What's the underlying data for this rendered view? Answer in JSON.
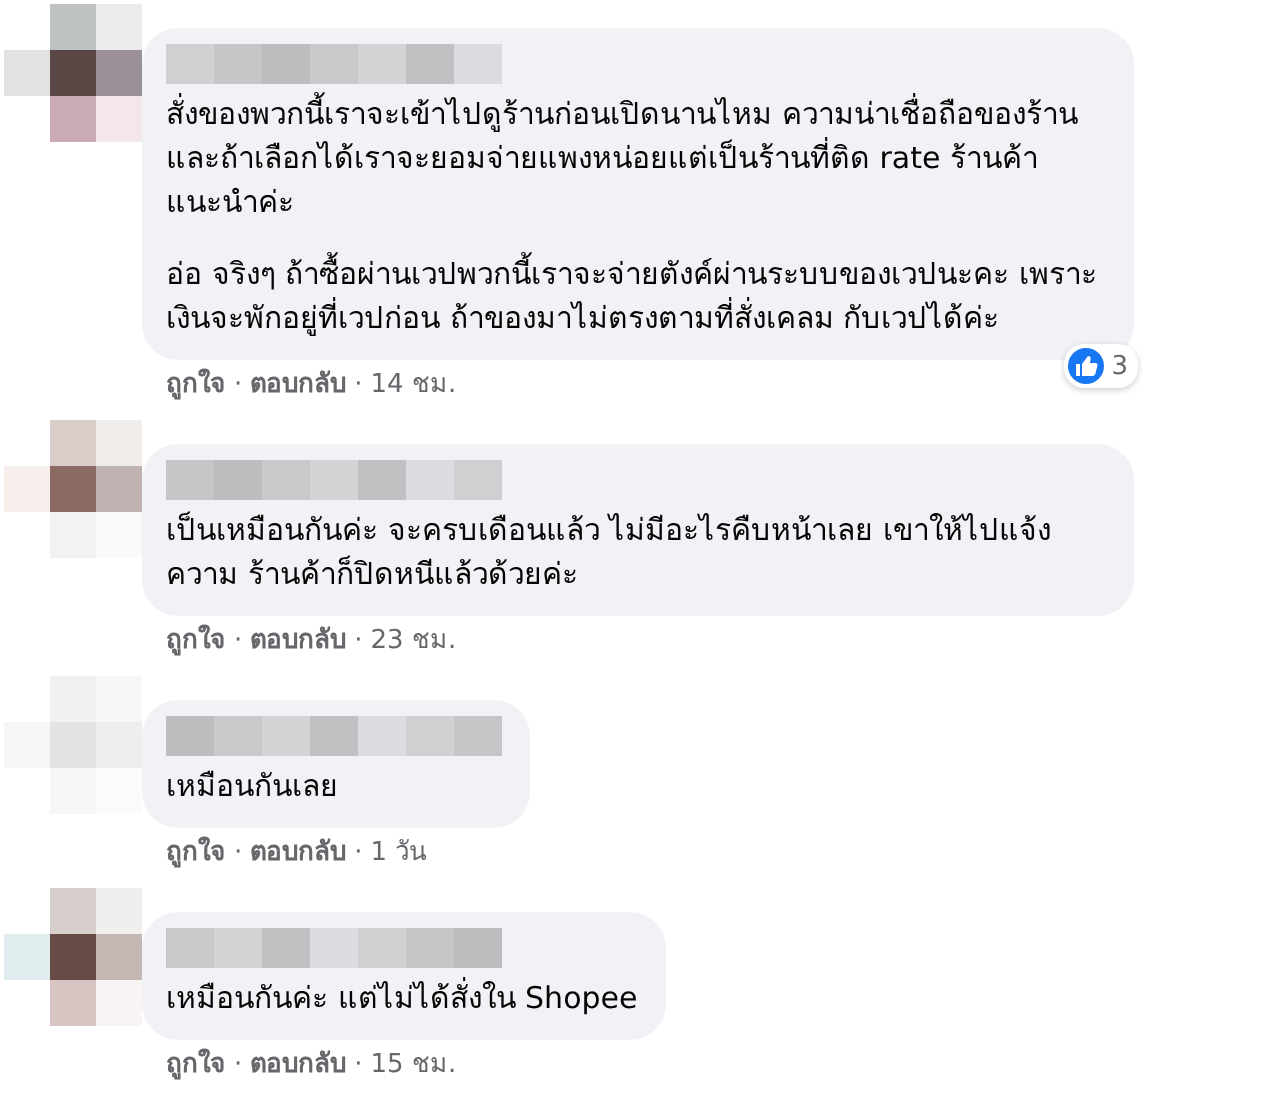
{
  "comments": [
    {
      "paragraphs": [
        "สั่งของพวกนี้เราจะเข้าไปดูร้านก่อนเปิดนานไหม ความน่าเชื่อถือของร้าน และถ้าเลือกได้เราจะยอมจ่ายแพงหน่อยแต่เป็นร้านที่ติด rate ร้านค้าแนะนำค่ะ",
        "อ่อ จริงๆ ถ้าซื้อผ่านเวปพวกนี้เราจะจ่ายตังค์ผ่านระบบของเวปนะคะ เพราะเงินจะพักอยู่ที่เวปก่อน ถ้าของมาไม่ตรงตามที่สั่งเคลม กับเวปได้ค่ะ"
      ],
      "reactions": {
        "count": "3"
      },
      "actions": [
        {
          "kind": "link",
          "text": "ถูกใจ"
        },
        {
          "kind": "sep",
          "text": "·"
        },
        {
          "kind": "link",
          "text": "ตอบกลับ"
        },
        {
          "kind": "sep",
          "text": "·"
        },
        {
          "kind": "time",
          "text": "14 ชม."
        }
      ]
    },
    {
      "paragraphs": [
        "เป็นเหมือนกันค่ะ จะครบเดือนแล้ว ไม่มีอะไรคืบหน้าเลย เขาให้ไปแจ้งความ ร้านค้าก็ปิดหนีแล้วด้วยค่ะ"
      ],
      "actions": [
        {
          "kind": "link",
          "text": "ถูกใจ"
        },
        {
          "kind": "sep",
          "text": "·"
        },
        {
          "kind": "link",
          "text": "ตอบกลับ"
        },
        {
          "kind": "sep",
          "text": "·"
        },
        {
          "kind": "time",
          "text": "23 ชม."
        }
      ]
    },
    {
      "paragraphs": [
        "เหมือนกันเลย"
      ],
      "actions": [
        {
          "kind": "link",
          "text": "ถูกใจ"
        },
        {
          "kind": "sep",
          "text": "·"
        },
        {
          "kind": "link",
          "text": "ตอบกลับ"
        },
        {
          "kind": "sep",
          "text": "·"
        },
        {
          "kind": "time",
          "text": "1 วัน"
        }
      ]
    },
    {
      "paragraphs": [
        "เหมือนกันค่ะ แต่ไม่ได้สั่งใน Shopee"
      ],
      "actions": [
        {
          "kind": "link",
          "text": "ถูกใจ"
        },
        {
          "kind": "sep",
          "text": "·"
        },
        {
          "kind": "link",
          "text": "ตอบกลับ"
        },
        {
          "kind": "sep",
          "text": "·"
        },
        {
          "kind": "time",
          "text": "15 ชม."
        }
      ]
    }
  ]
}
